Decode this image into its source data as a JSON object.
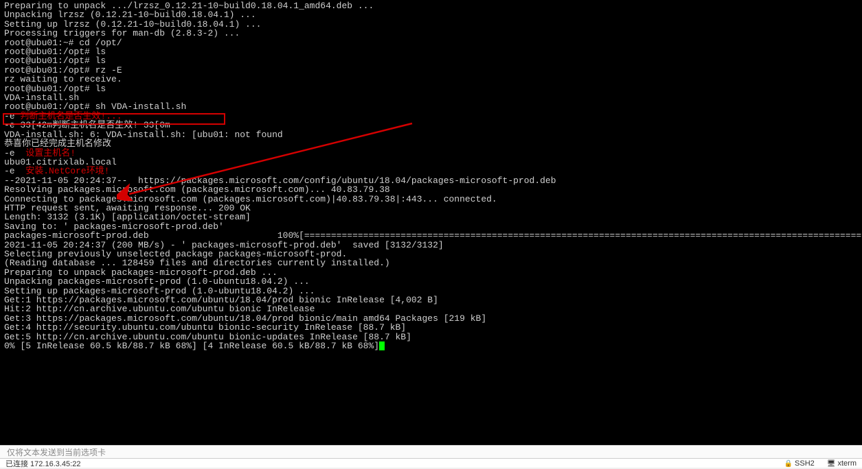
{
  "terminal": {
    "lines": [
      {
        "t": "Preparing to unpack .../lrzsz_0.12.21-10~build0.18.04.1_amd64.deb ..."
      },
      {
        "t": "Unpacking lrzsz (0.12.21-10~build0.18.04.1) ..."
      },
      {
        "t": "Setting up lrzsz (0.12.21-10~build0.18.04.1) ..."
      },
      {
        "t": "Processing triggers for man-db (2.8.3-2) ..."
      },
      {
        "t": "root@ubu01:~# cd /opt/"
      },
      {
        "t": "root@ubu01:/opt# ls"
      },
      {
        "t": "root@ubu01:/opt# ls"
      },
      {
        "t": "root@ubu01:/opt# rz -E"
      },
      {
        "t": "rz waiting to receive."
      },
      {
        "t": "root@ubu01:/opt# ls"
      },
      {
        "t": "VDA-install.sh"
      },
      {
        "t": "root@ubu01:/opt# sh VDA-install.sh"
      },
      {
        "t": "-e 判断主机名是否生效!...",
        "c": "red-text",
        "pre": "-e "
      },
      {
        "t": "-e 33[42m判断主机名是否生效! 33[0m"
      },
      {
        "t": "VDA-install.sh: 6: VDA-install.sh: [ubu01: not found"
      },
      {
        "t": "恭喜你已经完成主机名修改"
      },
      {
        "t": "-e  设置主机名!",
        "c": "red-text",
        "pre": "-e  "
      },
      {
        "t": "ubu01.citrixlab.local"
      },
      {
        "t": "-e  安装.NetCore环境!",
        "c": "red-text",
        "pre": "-e  "
      },
      {
        "t": "--2021-11-05 20:24:37--  https://packages.microsoft.com/config/ubuntu/18.04/packages-microsoft-prod.deb"
      },
      {
        "t": "Resolving packages.microsoft.com (packages.microsoft.com)... 40.83.79.38"
      },
      {
        "t": "Connecting to packages.microsoft.com (packages.microsoft.com)|40.83.79.38|:443... connected."
      },
      {
        "t": "HTTP request sent, awaiting response... 200 OK"
      },
      {
        "t": "Length: 3132 (3.1K) [application/octet-stream]"
      },
      {
        "t": "Saving to: ' packages-microsoft-prod.deb'"
      },
      {
        "t": ""
      },
      {
        "t": "packages-microsoft-prod.deb                        100%[===================================================================================================================="
      },
      {
        "t": ""
      },
      {
        "t": "2021-11-05 20:24:37 (200 MB/s) - ' packages-microsoft-prod.deb'  saved [3132/3132]"
      },
      {
        "t": ""
      },
      {
        "t": "Selecting previously unselected package packages-microsoft-prod."
      },
      {
        "t": "(Reading database ... 128459 files and directories currently installed.)"
      },
      {
        "t": "Preparing to unpack packages-microsoft-prod.deb ..."
      },
      {
        "t": "Unpacking packages-microsoft-prod (1.0-ubuntu18.04.2) ..."
      },
      {
        "t": "Setting up packages-microsoft-prod (1.0-ubuntu18.04.2) ..."
      },
      {
        "t": "Get:1 https://packages.microsoft.com/ubuntu/18.04/prod bionic InRelease [4,002 B]"
      },
      {
        "t": "Hit:2 http://cn.archive.ubuntu.com/ubuntu bionic InRelease"
      },
      {
        "t": "Get:3 https://packages.microsoft.com/ubuntu/18.04/prod bionic/main amd64 Packages [219 kB]"
      },
      {
        "t": "Get:4 http://security.ubuntu.com/ubuntu bionic-security InRelease [88.7 kB]"
      },
      {
        "t": "Get:5 http://cn.archive.ubuntu.com/ubuntu bionic-updates InRelease [88.7 kB]"
      },
      {
        "t": "0% [5 InRelease 60.5 kB/88.7 kB 68%] [4 InRelease 60.5 kB/88.7 kB 68%]",
        "cursor": true
      }
    ]
  },
  "annotation": {
    "highlight_command": "root@ubu01:/opt# sh VDA-install.sh"
  },
  "input_bar": {
    "placeholder": "仅将文本发送到当前选项卡"
  },
  "status": {
    "left": "已连接 172.16.3.45:22",
    "ssh": "SSH2",
    "term": "xterm"
  }
}
